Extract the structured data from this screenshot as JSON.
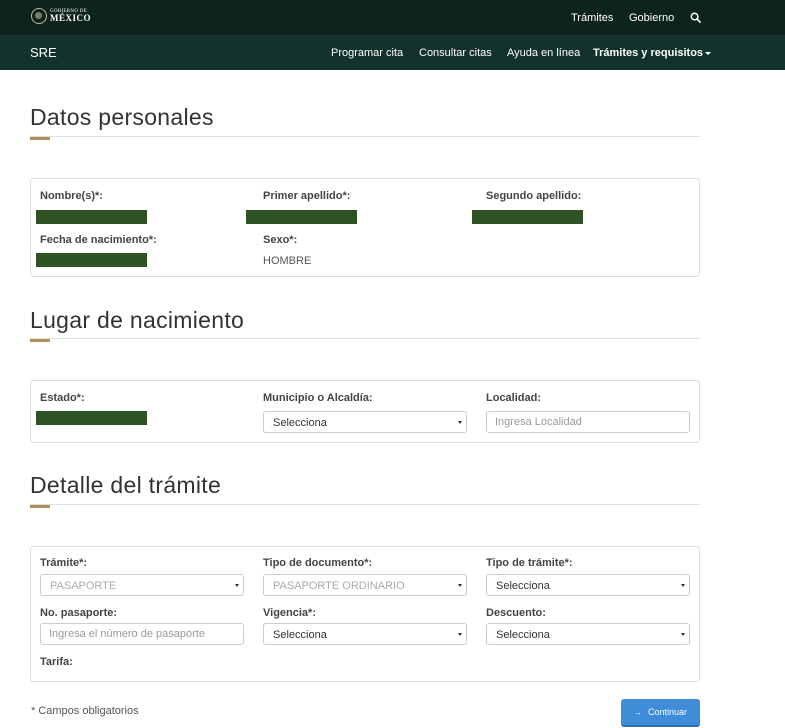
{
  "header": {
    "logo_line1": "GOBIERNO DE",
    "logo_line2": "MÉXICO",
    "links": [
      "Trámites",
      "Gobierno"
    ]
  },
  "subnav": {
    "brand": "SRE",
    "links": [
      "Programar cita",
      "Consultar citas",
      "Ayuda en línea",
      "Trámites y requisitos"
    ]
  },
  "personal": {
    "title": "Datos personales",
    "nombre_label": "Nombre(s)*:",
    "primer_apellido_label": "Primer apellido*:",
    "segundo_apellido_label": "Segundo apellido:",
    "fecha_label": "Fecha de nacimiento*:",
    "sexo_label": "Sexo*:",
    "sexo_value": "HOMBRE"
  },
  "birthplace": {
    "title": "Lugar de nacimiento",
    "estado_label": "Estado*:",
    "municipio_label": "Municipio o Alcaldía:",
    "municipio_value": "Selecciona",
    "localidad_label": "Localidad:",
    "localidad_placeholder": "Ingresa Localidad"
  },
  "procedure": {
    "title": "Detalle del trámite",
    "tramite_label": "Trámite*:",
    "tramite_value": "PASAPORTE",
    "tipo_documento_label": "Tipo de documento*:",
    "tipo_documento_value": "PASAPORTE ORDINARIO",
    "tipo_tramite_label": "Tipo de trámite*:",
    "tipo_tramite_value": "Selecciona",
    "pasaporte_label": "No. pasaporte:",
    "pasaporte_placeholder": "Ingresa el número de pasaporte",
    "vigencia_label": "Vigencia*:",
    "vigencia_value": "Selecciona",
    "descuento_label": "Descuento:",
    "descuento_value": "Selecciona",
    "tarifa_label": "Tarifa:"
  },
  "footer": {
    "required_note": "* Campos obligatorios",
    "continue_label": "Continuar",
    "continue_arrow": "→"
  },
  "colors": {
    "topbar": "#0c231e",
    "subbar": "#13322b",
    "accent": "#b38e5d",
    "redaction": "#2f5225",
    "button": "#3f8dd8"
  },
  "icons": {
    "search": "search-icon",
    "dropdown": "chevron-down-icon",
    "logo": "mexico-seal-icon"
  }
}
